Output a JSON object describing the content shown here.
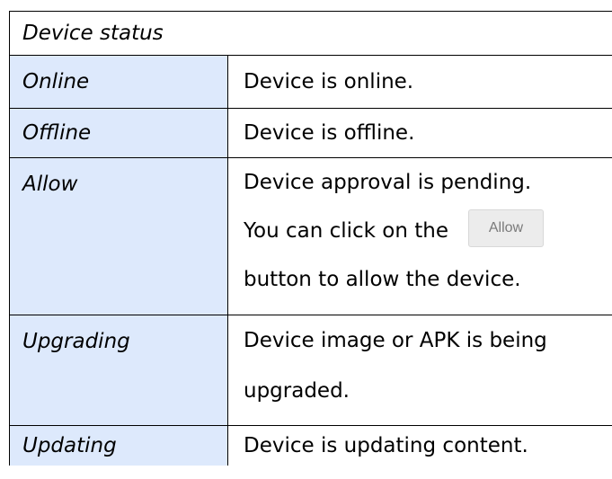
{
  "table": {
    "header": "Device status",
    "rows": [
      {
        "term": "Online",
        "lines": [
          "Device is online."
        ]
      },
      {
        "term": "Offline",
        "lines": [
          "Device is offline."
        ]
      },
      {
        "term": "Allow",
        "lines": [
          "Device approval is pending.",
          "You can click on the",
          "button to allow the device."
        ],
        "button_label": "Allow"
      },
      {
        "term": "Upgrading",
        "lines": [
          "Device image or APK is being",
          "upgraded."
        ]
      },
      {
        "term": "Updating",
        "lines": [
          "Device is updating content."
        ]
      }
    ]
  },
  "colors": {
    "term_background": "#dde9fc",
    "border": "#000000",
    "button_background": "#ececec",
    "button_text": "#7a7a7a"
  }
}
